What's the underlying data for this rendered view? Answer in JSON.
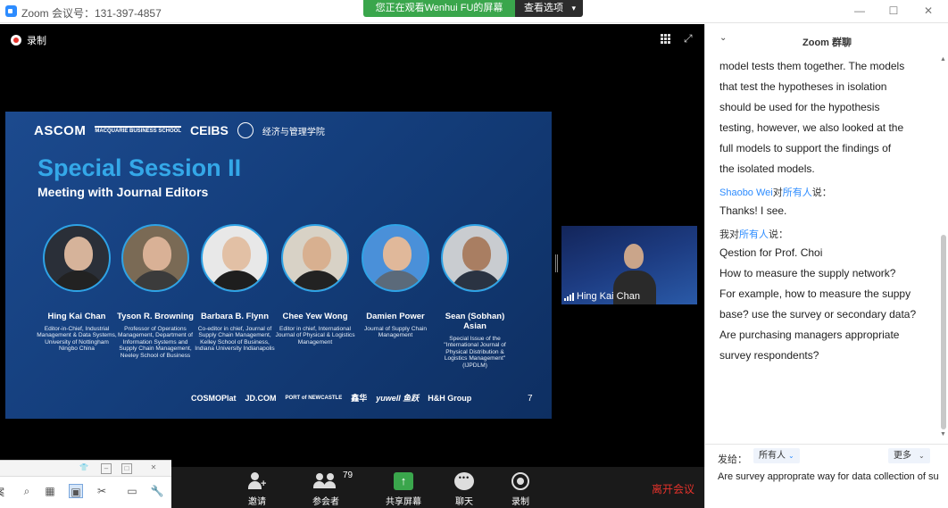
{
  "titlebar": {
    "title": "Zoom 会议号：131-397-4857",
    "share_banner": "您正在观看Wenhui  FU的屏幕",
    "view_options": "查看选项",
    "minimize": "—",
    "maximize": "☐",
    "close": "✕"
  },
  "meeting": {
    "recording_label": "录制",
    "slide": {
      "logos": {
        "ascom": "ASCOM",
        "macquarie": "MACQUARIE BUSINESS SCHOOL",
        "ceibs": "CEIBS",
        "cn_school": "经济与管理学院"
      },
      "title": "Special Session II",
      "subtitle": "Meeting with Journal Editors",
      "editors": [
        {
          "name": "Hing Kai Chan",
          "desc": "Editor-in-Chief, Industrial Management & Data Systems, University of Nottingham Ningbo China"
        },
        {
          "name": "Tyson R. Browning",
          "desc": "Professor of Operations Management, Department of Information Systems and Supply Chain Management, Neeley School of Business"
        },
        {
          "name": "Barbara B. Flynn",
          "desc": "Co-editor in chief, Journal of Supply Chain Management, Kelley School of Business, Indiana University Indianapolis"
        },
        {
          "name": "Chee Yew Wong",
          "desc": "Editor in chief, International Journal of Physical & Logistics Management"
        },
        {
          "name": "Damien Power",
          "desc": "Journal of Supply Chain Management"
        },
        {
          "name": "Sean (Sobhan) Asian",
          "desc": "Special Issue of the \"International Journal of Physical Distribution & Logistics Management\" (IJPDLM)"
        }
      ],
      "sponsors": [
        "COSMOPlat",
        "JD.COM",
        "PORT of NEWCASTLE",
        "鑫华",
        "yuwell 鱼跃",
        "H&H Group"
      ],
      "page_number": "7"
    },
    "speaker_name": "Hing Kai Chan",
    "controls": {
      "invite": "邀请",
      "participants": "参会者",
      "participants_count": "79",
      "share": "共享屏幕",
      "chat": "聊天",
      "record": "录制",
      "leave": "离开会议"
    }
  },
  "chat": {
    "title": "Zoom 群聊",
    "messages_top": [
      "model tests them together. The models",
      "that test the hypotheses in isolation",
      "should be used for the hypothesis",
      "testing, however, we also looked at the",
      "full models to support the findings of",
      "the isolated models."
    ],
    "msg2": {
      "from": "Shaobo Wei",
      "to_prefix": "对",
      "to": "所有人",
      "said": "说：",
      "lines": [
        "Thanks! I see."
      ]
    },
    "msg3": {
      "from": "我",
      "to_prefix": "对",
      "to": "所有人",
      "said": "说：",
      "lines": [
        "Qestion for Prof. Choi",
        "How to measure the supply network?",
        "For example, how to measure the suppy",
        "base? use the survey or secondary data?",
        "Are purchasing managers appropriate",
        "survey respondents?"
      ]
    },
    "send_to_label": "发给：",
    "send_to_value": "所有人",
    "more": "更多",
    "input_text": "Are survey approprate way for data collection of su"
  },
  "colors": {
    "zoom_blue": "#2d8cff",
    "share_green": "#3aa64c",
    "leave_red": "#e5322b",
    "slide_title": "#34a8e8"
  }
}
